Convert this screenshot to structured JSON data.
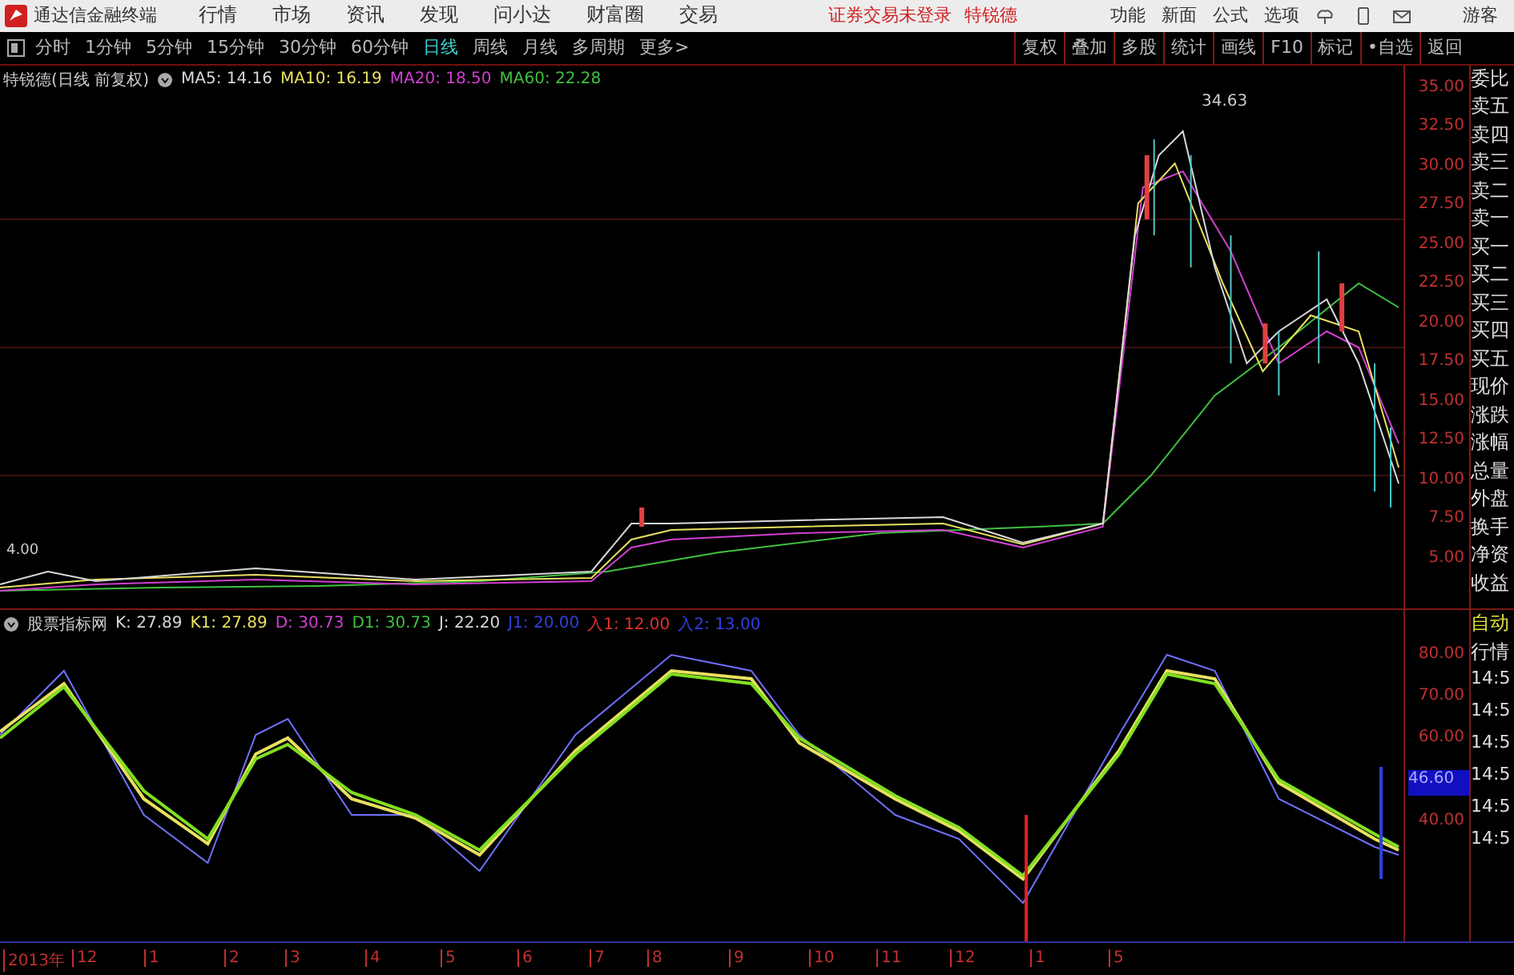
{
  "title_bar": {
    "app_name": "通达信金融终端",
    "menu": [
      "行情",
      "市场",
      "资讯",
      "发现",
      "问小达",
      "财富圈",
      "交易"
    ],
    "status": "证券交易未登录",
    "stock": "特锐德",
    "actions": [
      "功能",
      "新面",
      "公式",
      "选项"
    ],
    "user": "游客"
  },
  "period_tabs": [
    {
      "label": "分时",
      "selected": false
    },
    {
      "label": "1分钟",
      "selected": false
    },
    {
      "label": "5分钟",
      "selected": false
    },
    {
      "label": "15分钟",
      "selected": false
    },
    {
      "label": "30分钟",
      "selected": false
    },
    {
      "label": "60分钟",
      "selected": false
    },
    {
      "label": "日线",
      "selected": true
    },
    {
      "label": "周线",
      "selected": false
    },
    {
      "label": "月线",
      "selected": false
    },
    {
      "label": "多周期",
      "selected": false
    },
    {
      "label": "更多>",
      "selected": false
    }
  ],
  "tool_buttons": [
    "复权",
    "叠加",
    "多股",
    "统计",
    "画线",
    "F10",
    "标记",
    "•自选",
    "返回"
  ],
  "price_chart": {
    "caption": "特锐德(日线 前复权)",
    "legend": [
      {
        "label": "MA5: 14.16",
        "color": "#d8d8d8"
      },
      {
        "label": "MA10: 16.19",
        "color": "#e8e060"
      },
      {
        "label": "MA20: 18.50",
        "color": "#d040d0"
      },
      {
        "label": "MA60: 22.28",
        "color": "#40c040"
      }
    ],
    "high_label": "34.63",
    "low_label": "4.00",
    "axis": [
      "35.00",
      "32.50",
      "30.00",
      "27.50",
      "25.00",
      "22.50",
      "20.00",
      "17.50",
      "15.00",
      "12.50",
      "10.00",
      "7.50",
      "5.00"
    ]
  },
  "quote_panel": [
    "委比",
    "卖五",
    "卖四",
    "卖三",
    "卖二",
    "卖一",
    "买一",
    "买二",
    "买三",
    "买四",
    "买五",
    "现价",
    "涨跌",
    "涨幅",
    "总量",
    "外盘",
    "换手",
    "净资",
    "收益"
  ],
  "indicator": {
    "caption": "股票指标网",
    "legend": [
      {
        "label": "K: 27.89",
        "color": "#d8d8d8"
      },
      {
        "label": "K1: 27.89",
        "color": "#e8e060"
      },
      {
        "label": "D: 30.73",
        "color": "#d040d0"
      },
      {
        "label": "D1: 30.73",
        "color": "#40c040"
      },
      {
        "label": "J: 22.20",
        "color": "#d8d8d8"
      },
      {
        "label": "J1: 20.00",
        "color": "#3040e0"
      },
      {
        "label": "入1: 12.00",
        "color": "#e03030"
      },
      {
        "label": "入2: 13.00",
        "color": "#3040e0"
      }
    ],
    "axis": [
      "80.00",
      "70.00",
      "60.00",
      "40.00"
    ],
    "current_value": "46.60"
  },
  "tick_panel": {
    "header": [
      "自动",
      "行情"
    ],
    "times": [
      "14:5",
      "14:5",
      "14:5",
      "14:5",
      "14:5",
      "14:5"
    ]
  },
  "time_axis": [
    "2013年",
    "12",
    "1",
    "2",
    "3",
    "4",
    "5",
    "6",
    "7",
    "8",
    "9",
    "10",
    "11",
    "12",
    "1",
    "5"
  ]
}
